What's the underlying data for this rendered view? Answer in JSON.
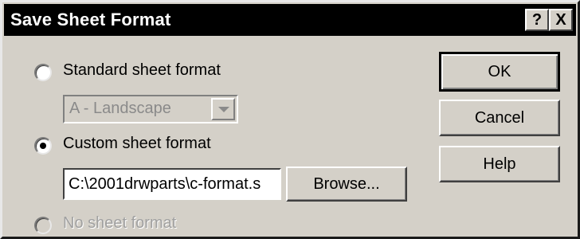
{
  "window": {
    "title": "Save Sheet Format",
    "help_glyph": "?",
    "close_glyph": "X"
  },
  "options": {
    "standard": {
      "label": "Standard sheet format",
      "checked": false,
      "enabled": true
    },
    "custom": {
      "label": "Custom sheet format",
      "checked": true,
      "enabled": true
    },
    "none": {
      "label": "No sheet format",
      "checked": false,
      "enabled": false
    }
  },
  "standard_select": {
    "value": "A - Landscape",
    "enabled": false
  },
  "custom_path": {
    "value": "C:\\2001drwparts\\c-format.s"
  },
  "buttons": {
    "browse": "Browse...",
    "ok": "OK",
    "cancel": "Cancel",
    "help": "Help"
  }
}
